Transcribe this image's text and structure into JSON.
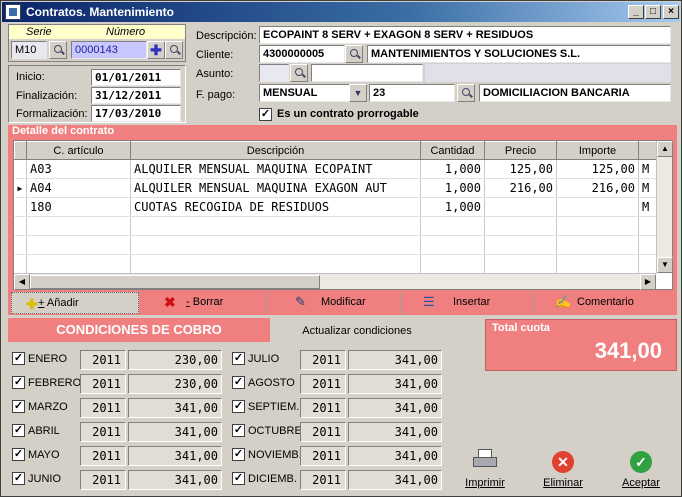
{
  "window": {
    "title": "Contratos. Mantenimiento"
  },
  "header": {
    "serie_label": "Serie",
    "numero_label": "Número",
    "serie": "M10",
    "numero": "0000143",
    "inicio_label": "Inicio:",
    "inicio": "01/01/2011",
    "fin_label": "Finalización:",
    "fin": "31/12/2011",
    "form_label": "Formalización:",
    "form": "17/03/2010",
    "desc_label": "Descripción:",
    "desc": "ECOPAINT 8 SERV + EXAGON 8 SERV + RESIDUOS",
    "cliente_label": "Cliente:",
    "cliente_code": "4300000005",
    "cliente_name": "MANTENIMIENTOS Y SOLUCIONES S.L.",
    "asunto_label": "Asunto:",
    "fpago_label": "F. pago:",
    "fpago": "MENSUAL",
    "fpago_code": "23",
    "fpago_name": "DOMICILIACION BANCARIA",
    "prorrogable_label": "Es un contrato prorrogable"
  },
  "detalle": {
    "title": "Detalle del contrato",
    "columns": [
      "C. artículo",
      "Descripción",
      "Cantidad",
      "Precio",
      "Importe"
    ],
    "rows": [
      {
        "art": "A03",
        "desc": "ALQUILER MENSUAL MAQUINA ECOPAINT",
        "cant": "1,000",
        "precio": "125,00",
        "importe": "125,00",
        "extra": "M"
      },
      {
        "art": "A04",
        "desc": "ALQUILER MENSUAL MAQUINA EXAGON AUT",
        "cant": "1,000",
        "precio": "216,00",
        "importe": "216,00",
        "extra": "M"
      },
      {
        "art": "180",
        "desc": "CUOTAS RECOGIDA DE RESIDUOS",
        "cant": "1,000",
        "precio": "",
        "importe": "",
        "extra": "M"
      }
    ]
  },
  "toolbar": {
    "add": "Añadir",
    "del": "Borrar",
    "mod": "Modificar",
    "ins": "Insertar",
    "com": "Comentario",
    "add_key": "+",
    "del_key": "-"
  },
  "condiciones": {
    "title": "CONDICIONES DE COBRO",
    "update": "Actualizar condiciones",
    "months": [
      {
        "name": "ENERO",
        "year": "2011",
        "amount": "230,00"
      },
      {
        "name": "FEBRERO",
        "year": "2011",
        "amount": "230,00"
      },
      {
        "name": "MARZO",
        "year": "2011",
        "amount": "341,00"
      },
      {
        "name": "ABRIL",
        "year": "2011",
        "amount": "341,00"
      },
      {
        "name": "MAYO",
        "year": "2011",
        "amount": "341,00"
      },
      {
        "name": "JUNIO",
        "year": "2011",
        "amount": "341,00"
      },
      {
        "name": "JULIO",
        "year": "2011",
        "amount": "341,00"
      },
      {
        "name": "AGOSTO",
        "year": "2011",
        "amount": "341,00"
      },
      {
        "name": "SEPTIEM.",
        "year": "2011",
        "amount": "341,00"
      },
      {
        "name": "OCTUBRE",
        "year": "2011",
        "amount": "341,00"
      },
      {
        "name": "NOVIEMB.",
        "year": "2011",
        "amount": "341,00"
      },
      {
        "name": "DICIEMB.",
        "year": "2011",
        "amount": "341,00"
      }
    ]
  },
  "total": {
    "label": "Total cuota",
    "value": "341,00"
  },
  "actions": {
    "print": "Imprimir",
    "delete": "Eliminar",
    "accept": "Aceptar"
  },
  "colors": {
    "accent": "#f08080",
    "title_start": "#0a246a"
  }
}
